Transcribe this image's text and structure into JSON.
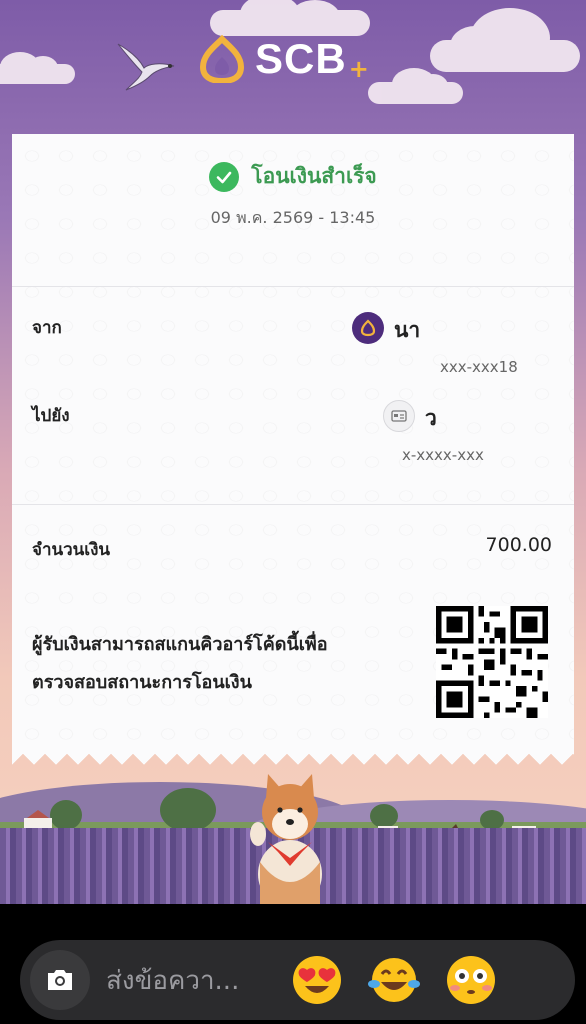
{
  "brand": {
    "name": "SCB",
    "plus": "+"
  },
  "status": {
    "text": "โอนเงินสำเร็จ",
    "datetime": "09 พ.ค. 2569 - 13:45",
    "icon": "check-circle-icon",
    "color": "#3cb85e"
  },
  "from": {
    "label": "จาก",
    "name": "นา",
    "account": "xxx-xxx18"
  },
  "to": {
    "label": "ไปยัง",
    "name": "ว",
    "account": "x-xxxx-xxx"
  },
  "amount": {
    "label": "จำนวนเงิน",
    "value": "700.00"
  },
  "qr": {
    "line1": "ผู้รับเงินสามารถสแกนคิวอาร์โค้ดนี้เพื่อ",
    "line2": "ตรวจสอบสถานะการโอนเงิน"
  },
  "composer": {
    "placeholder": "ส่งข้อควา...",
    "reactions": [
      "heart-eyes-emoji",
      "tears-of-joy-emoji",
      "flushed-emoji"
    ]
  }
}
